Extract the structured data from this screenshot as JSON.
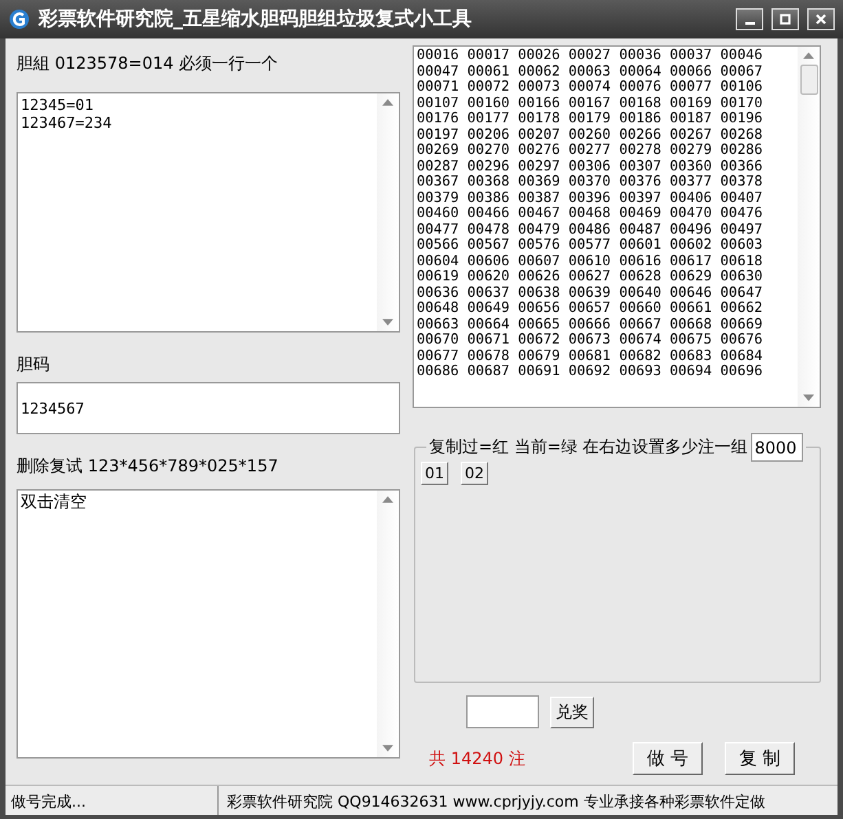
{
  "window": {
    "title": "彩票软件研究院_五星缩水胆码胆组垃圾复式小工具"
  },
  "dan_zu": {
    "label": "胆組 0123578=014 必须一行一个",
    "lines": [
      "12345=01",
      "123467=234"
    ]
  },
  "dan_ma": {
    "label": "胆码",
    "value": "1234567"
  },
  "delete_fushi": {
    "label": "删除复试 123*456*789*025*157",
    "value": "双击清空"
  },
  "result_rows": [
    "00016 00017 00026 00027 00036 00037 00046",
    "00047 00061 00062 00063 00064 00066 00067",
    "00071 00072 00073 00074 00076 00077 00106",
    "00107 00160 00166 00167 00168 00169 00170",
    "00176 00177 00178 00179 00186 00187 00196",
    "00197 00206 00207 00260 00266 00267 00268",
    "00269 00270 00276 00277 00278 00279 00286",
    "00287 00296 00297 00306 00307 00360 00366",
    "00367 00368 00369 00370 00376 00377 00378",
    "00379 00386 00387 00396 00397 00406 00407",
    "00460 00466 00467 00468 00469 00470 00476",
    "00477 00478 00479 00486 00487 00496 00497",
    "00566 00567 00576 00577 00601 00602 00603",
    "00604 00606 00607 00610 00616 00617 00618",
    "00619 00620 00626 00627 00628 00629 00630",
    "00636 00637 00638 00639 00640 00646 00647",
    "00648 00649 00656 00657 00660 00661 00662",
    "00663 00664 00665 00666 00667 00668 00669",
    "00670 00671 00672 00673 00674 00675 00676",
    "00677 00678 00679 00681 00682 00683 00684",
    "00686 00687 00691 00692 00693 00694 00696"
  ],
  "group": {
    "legend": "复制过=红 当前=绿 在右边设置多少注一组",
    "group_size": "8000",
    "buttons": [
      "01",
      "02"
    ]
  },
  "prize": {
    "button": "兑奖"
  },
  "total": "共 14240 注",
  "actions": [
    "做 号",
    "复 制"
  ],
  "status_bar": [
    "做号完成...",
    "彩票软件研究院 QQ914632631 www.cprjyjy.com 专业承接各种彩票软件定做"
  ]
}
